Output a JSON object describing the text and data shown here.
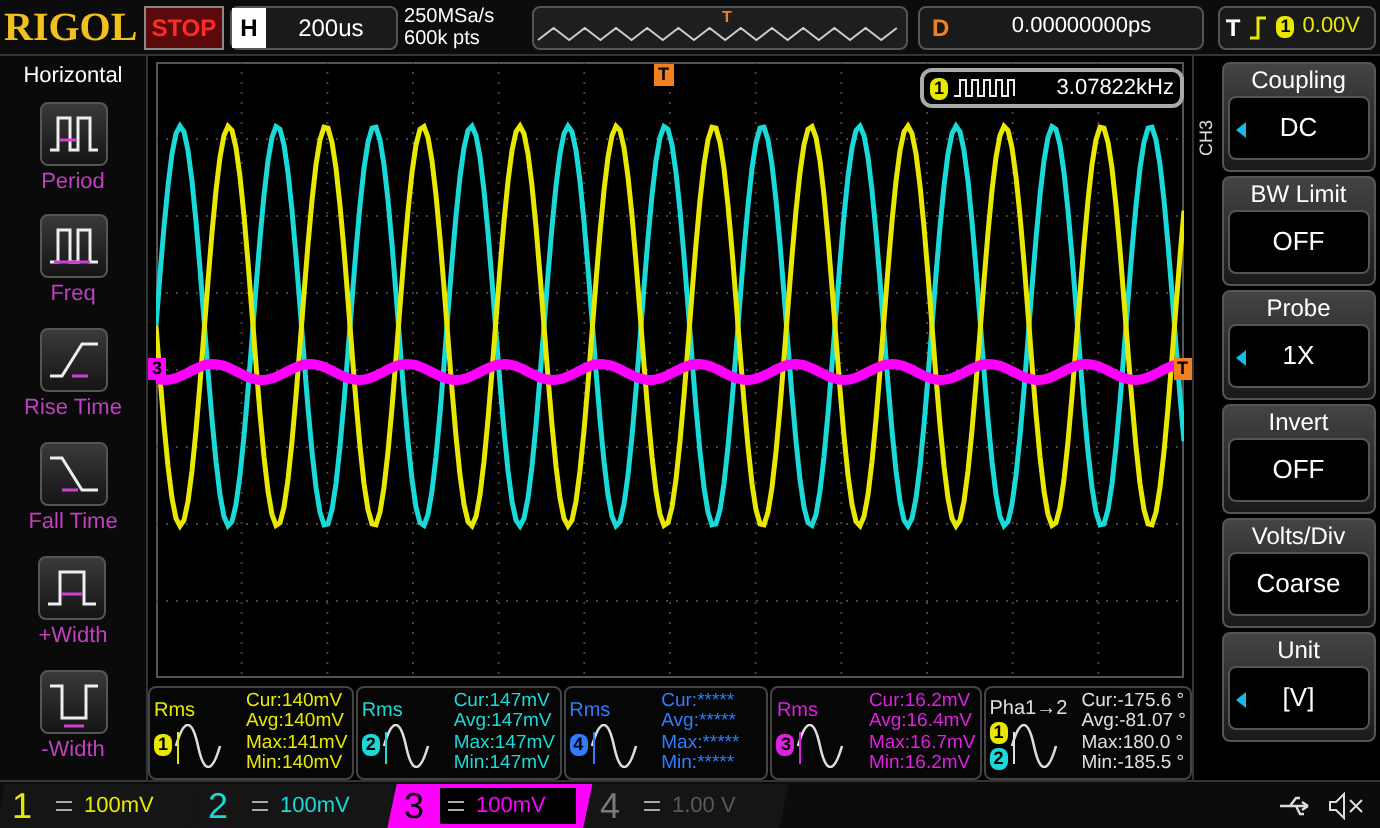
{
  "top_bar": {
    "logo": "RIGOL",
    "run_state": "STOP",
    "horizontal": {
      "label": "H",
      "value": "200us"
    },
    "sample_rate": "250MSa/s",
    "memory_depth": "600k pts",
    "trigger_position": "T",
    "delay": {
      "label": "D",
      "value": "0.00000000ps"
    },
    "trigger": {
      "label": "T",
      "source": "1",
      "level": "0.00V"
    }
  },
  "left_menu": {
    "title": "Horizontal",
    "items": [
      {
        "kind": "period",
        "label": "Period"
      },
      {
        "kind": "freq",
        "label": "Freq"
      },
      {
        "kind": "rise",
        "label": "Rise Time"
      },
      {
        "kind": "fall",
        "label": "Fall Time"
      },
      {
        "kind": "pwidth",
        "label": "+Width"
      },
      {
        "kind": "nwidth",
        "label": "-Width"
      }
    ]
  },
  "screen": {
    "trigger_marker": "T",
    "channel_marker": "3",
    "trigger_level_marker": "T",
    "frequency_counter": {
      "source": "1",
      "value": "3.07822kHz"
    }
  },
  "right_menu": {
    "channel": "CH3",
    "items": [
      {
        "title": "Coupling",
        "value": "DC",
        "adjustable": true
      },
      {
        "title": "BW Limit",
        "value": "OFF",
        "adjustable": false
      },
      {
        "title": "Probe",
        "value": "1X",
        "adjustable": true
      },
      {
        "title": "Invert",
        "value": "OFF",
        "adjustable": false
      },
      {
        "title": "Volts/Div",
        "value": "Coarse",
        "adjustable": false
      },
      {
        "title": "Unit",
        "value": "[V]",
        "adjustable": true
      }
    ]
  },
  "measurements": [
    {
      "kind": "rms",
      "title": "Rms",
      "sources": [
        "1"
      ],
      "color": "#e8e800",
      "lines": [
        "Cur:140mV",
        "Avg:140mV",
        "Max:141mV",
        "Min:140mV"
      ]
    },
    {
      "kind": "rms",
      "title": "Rms",
      "sources": [
        "2"
      ],
      "color": "#19d9d9",
      "lines": [
        "Cur:147mV",
        "Avg:147mV",
        "Max:147mV",
        "Min:147mV"
      ]
    },
    {
      "kind": "rms",
      "title": "Rms",
      "sources": [
        "4"
      ],
      "color": "#2f7dff",
      "lines": [
        "Cur:*****",
        "Avg:*****",
        "Max:*****",
        "Min:*****"
      ]
    },
    {
      "kind": "rms",
      "title": "Rms",
      "sources": [
        "3"
      ],
      "color": "#e020e0",
      "lines": [
        "Cur:16.2mV",
        "Avg:16.4mV",
        "Max:16.7mV",
        "Min:16.2mV"
      ]
    },
    {
      "kind": "phase",
      "title": "Pha1→2",
      "sources": [
        "1",
        "2"
      ],
      "color": "#e0e0e0",
      "lines": [
        "Cur:-175.6 °",
        "Avg:-81.07 °",
        "Max:180.0 °",
        "Min:-185.5 °"
      ]
    }
  ],
  "channels": [
    {
      "number": "1",
      "scale": "100mV",
      "color": "#e8e800",
      "enabled": true,
      "selected": false
    },
    {
      "number": "2",
      "scale": "100mV",
      "color": "#19d9d9",
      "enabled": true,
      "selected": false
    },
    {
      "number": "3",
      "scale": "100mV",
      "color": "#ff00ff",
      "enabled": true,
      "selected": true
    },
    {
      "number": "4",
      "scale": "1.00 V",
      "color": "#7a7a7a",
      "enabled": false,
      "selected": false
    }
  ]
}
